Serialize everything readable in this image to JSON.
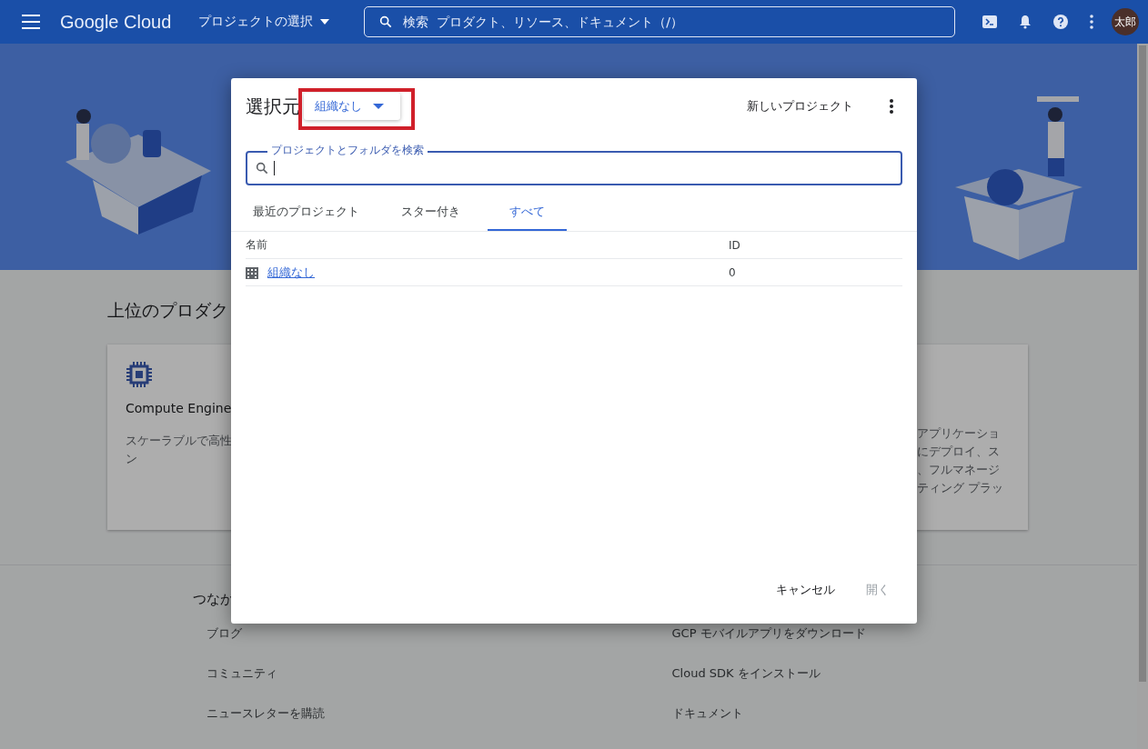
{
  "topbar": {
    "product": "Google Cloud",
    "project_picker": "プロジェクトの選択",
    "search_placeholder": "検索  プロダクト、リソース、ドキュメント（/）",
    "avatar": "太郎"
  },
  "page": {
    "section_title": "上位のプロダク",
    "cards": [
      {
        "title": "Compute Engine",
        "lines": [
          "スケーラブルで高性",
          "ン"
        ]
      },
      {
        "lines": [
          "アプリケーショ",
          "にデプロイ、ス",
          "、フルマネージ",
          "ティング プラッ"
        ]
      }
    ],
    "connect_title": "つなが",
    "links_left": [
      "ブログ",
      "コミュニティ",
      "ニュースレターを購読"
    ],
    "links_right": [
      "GCP モバイルアプリをダウンロード",
      "Cloud SDK をインストール",
      "ドキュメント"
    ]
  },
  "dialog": {
    "title": "選択元",
    "org_dropdown": "組織なし",
    "new_project": "新しいプロジェクト",
    "search": {
      "label": "プロジェクトとフォルダを検索",
      "focused": true
    },
    "tabs": [
      {
        "label": "最近のプロジェクト",
        "selected": false
      },
      {
        "label": "スター付き",
        "selected": false
      },
      {
        "label": "すべて",
        "selected": true
      }
    ],
    "columns": [
      "名前",
      "ID"
    ],
    "rows": [
      {
        "name": "組織なし",
        "id": "0"
      }
    ],
    "buttons": [
      {
        "label": "キャンセル",
        "disabled": false
      },
      {
        "label": "開く",
        "disabled": true
      }
    ]
  },
  "highlight": {
    "visible": true
  }
}
